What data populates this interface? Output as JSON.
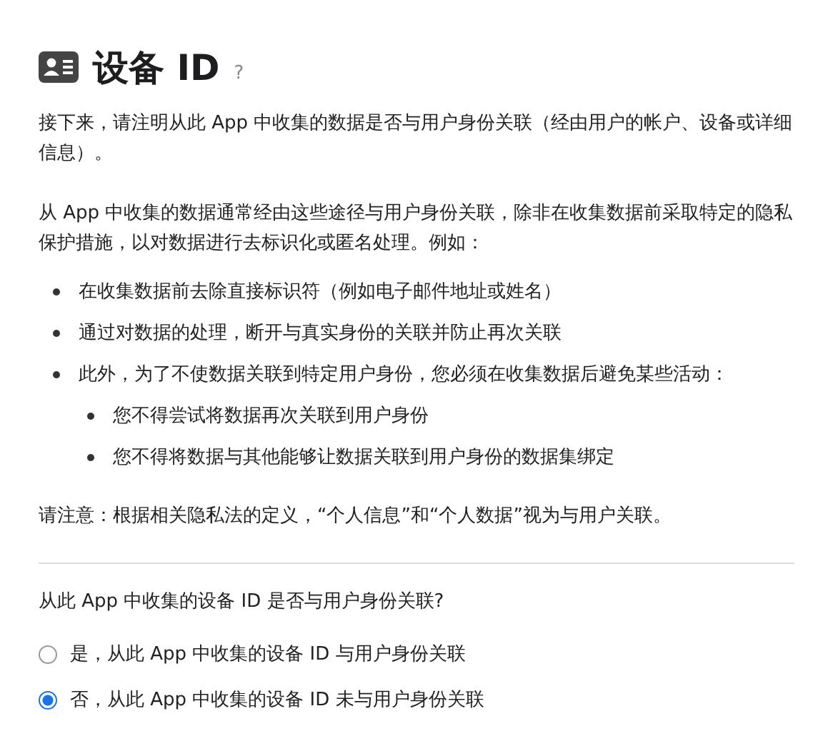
{
  "header": {
    "title": "设备 ID",
    "help": "?"
  },
  "paragraphs": [
    "接下来，请注明从此 App 中收集的数据是否与用户身份关联（经由用户的帐户、设备或详细信息）。",
    "从 App 中收集的数据通常经由这些途径与用户身份关联，除非在收集数据前采取特定的隐私保护措施，以对数据进行去标识化或匿名处理。例如："
  ],
  "bullets": [
    {
      "text": "在收集数据前去除直接标识符（例如电子邮件地址或姓名）"
    },
    {
      "text": "通过对数据的处理，断开与真实身份的关联并防止再次关联"
    },
    {
      "text": "此外，为了不使数据关联到特定用户身份，您必须在收集数据后避免某些活动：",
      "children": [
        {
          "text": "您不得尝试将数据再次关联到用户身份"
        },
        {
          "text": "您不得将数据与其他能够让数据关联到用户身份的数据集绑定"
        }
      ]
    }
  ],
  "note": "请注意：根据相关隐私法的定义，“个人信息”和“个人数据”视为与用户关联。",
  "question": "从此 App 中收集的设备 ID 是否与用户身份关联?",
  "options": [
    {
      "label": "是，从此 App 中收集的设备 ID 与用户身份关联",
      "selected": false
    },
    {
      "label": "否，从此 App 中收集的设备 ID 未与用户身份关联",
      "selected": true
    }
  ]
}
